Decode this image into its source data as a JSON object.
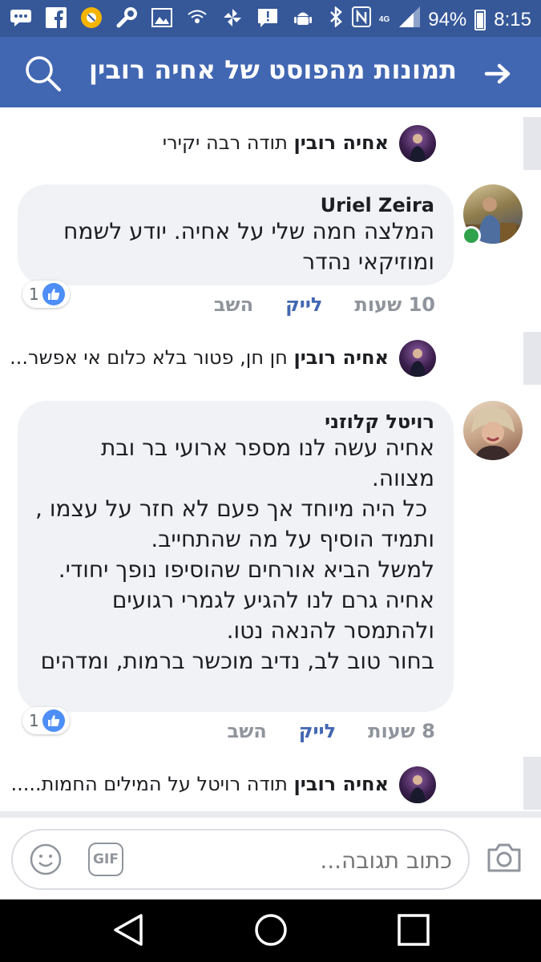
{
  "status_bar": {
    "battery": "94%",
    "time": "8:15",
    "network": "4G",
    "icons": [
      "message-icon",
      "facebook-icon",
      "chrome-icon",
      "wrench-icon",
      "image-icon",
      "wifi-icon",
      "pinwheel-icon",
      "alert-icon",
      "android-icon",
      "bluetooth-icon",
      "nfc-icon",
      "signal-icon",
      "battery-icon"
    ]
  },
  "header": {
    "title": "תמונות מהפוסט של אחיה רובין",
    "bg_color": "#4267b2"
  },
  "comments": [
    {
      "type": "reply",
      "author": "אחיה רובין",
      "text": "תודה רבה יקירי"
    },
    {
      "type": "comment",
      "author": "Uriel Zeira",
      "body": "המלצה חמה שלי על אחיה. יודע לשמח ומוזיקאי נהדר",
      "time": "10 שעות",
      "like_label": "לייק",
      "reply_label": "השב",
      "likes": "1"
    },
    {
      "type": "reply",
      "author": "אחיה רובין",
      "text": "חן חן, פטור בלא כלום אי אפשר..."
    },
    {
      "type": "comment",
      "author": "רויטל קלוזני",
      "body": "אחיה עשה לנו מספר ארועי בר ובת מצווה.\n כל היה מיוחד אך פעם לא חזר על עצמו , ותמיד הוסיף על מה שהתחייב.\nלמשל הביא אורחים שהוסיפו נופך יחודי.\nאחיה גרם לנו להגיע לגמרי רגועים ולהתמסר להנאה נטו.\nבחור טוב לב, נדיב מוכשר ברמות, ומדהים",
      "time": "8 שעות",
      "like_label": "לייק",
      "reply_label": "השב",
      "likes": "1"
    },
    {
      "type": "reply",
      "author": "אחיה רובין",
      "text": "תודה רויטל על המילים החמות....."
    }
  ],
  "composer": {
    "placeholder": "כתוב תגובה...",
    "gif_label": "GIF"
  },
  "navbar": {
    "buttons": [
      "back-icon",
      "home-icon",
      "recents-icon"
    ]
  }
}
